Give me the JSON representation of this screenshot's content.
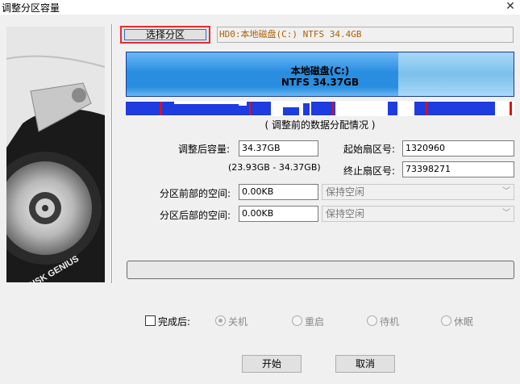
{
  "window": {
    "title": "调整分区容量"
  },
  "toolbar": {
    "select_partition_label": "选择分区"
  },
  "partition_info": "HD0:本地磁盘(C:) NTFS 34.4GB",
  "disk_bar": {
    "name": "本地磁盘(C:)",
    "detail": "NTFS 34.37GB",
    "used_fraction": 0.7,
    "color": "#2a8ee0"
  },
  "map_caption": "( 调整前的数据分配情况 )",
  "form": {
    "new_size_label": "调整后容量:",
    "new_size_value": "34.37GB",
    "range_hint": "(23.93GB - 34.37GB)",
    "start_sector_label": "起始扇区号:",
    "start_sector_value": "1320960",
    "end_sector_label": "终止扇区号:",
    "end_sector_value": "73398271",
    "space_before_label": "分区前部的空间:",
    "space_before_value": "0.00KB",
    "space_before_option": "保持空闲",
    "space_after_label": "分区后部的空间:",
    "space_after_value": "0.00KB",
    "space_after_option": "保持空闲"
  },
  "after_completion": {
    "label": "完成后:",
    "options": [
      "关机",
      "重启",
      "待机",
      "休眠"
    ],
    "selected": "关机"
  },
  "buttons": {
    "start": "开始",
    "cancel": "取消"
  },
  "logo_text": "DISK GENIUS",
  "icons": {
    "close": "close-icon",
    "dropdown": "chevron-down-icon"
  }
}
